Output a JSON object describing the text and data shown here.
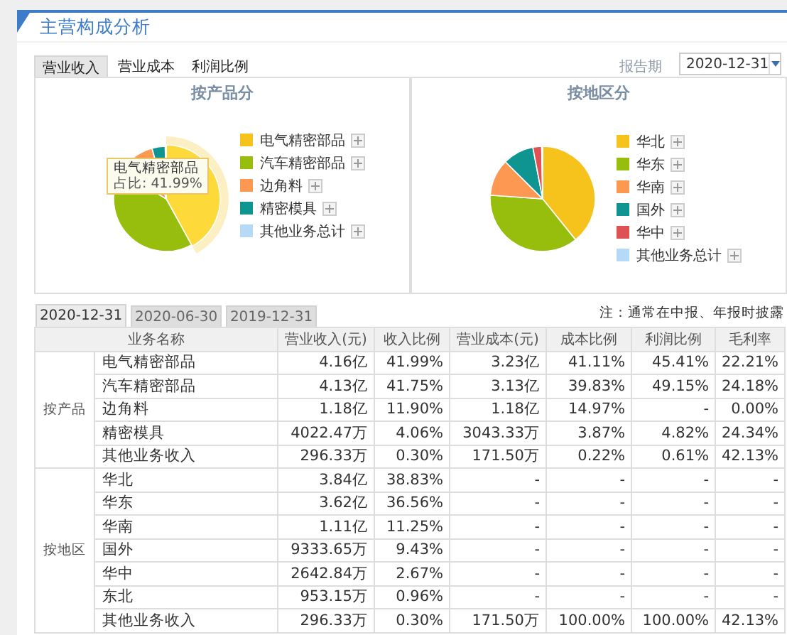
{
  "title": "主营构成分析",
  "tabs": [
    {
      "label": "营业收入",
      "selected": true
    },
    {
      "label": "营业成本",
      "selected": false
    },
    {
      "label": "利润比例",
      "selected": false
    }
  ],
  "report_period": {
    "label": "报告期",
    "value": "2020-12-31"
  },
  "charts": [
    {
      "title": "按产品分",
      "legend": [
        {
          "label": "电气精密部品",
          "color": "#f6c21c"
        },
        {
          "label": "汽车精密部品",
          "color": "#97be0d"
        },
        {
          "label": "边角料",
          "color": "#fd9853"
        },
        {
          "label": "精密模具",
          "color": "#0e9591"
        },
        {
          "label": "其他业务总计",
          "color": "#b5daf8"
        }
      ],
      "tooltip": {
        "title": "电气精密部品",
        "text": "占比: 41.99%"
      }
    },
    {
      "title": "按地区分",
      "legend": [
        {
          "label": "华北",
          "color": "#f6c21c"
        },
        {
          "label": "华东",
          "color": "#97be0d"
        },
        {
          "label": "华南",
          "color": "#fd9853"
        },
        {
          "label": "国外",
          "color": "#0e9591"
        },
        {
          "label": "华中",
          "color": "#de5253"
        },
        {
          "label": "其他业务总计",
          "color": "#b5daf8"
        }
      ]
    }
  ],
  "period_tabs": [
    {
      "label": "2020-12-31",
      "selected": true
    },
    {
      "label": "2020-06-30",
      "selected": false
    },
    {
      "label": "2019-12-31",
      "selected": false
    }
  ],
  "note": "注：通常在中报、年报时披露",
  "table": {
    "columns": [
      "业务名称",
      "营业收入(元)",
      "收入比例",
      "营业成本(元)",
      "成本比例",
      "利润比例",
      "毛利率"
    ],
    "groups": [
      {
        "label": "按产品",
        "rows": [
          [
            "电气精密部品",
            "4.16亿",
            "41.99%",
            "3.23亿",
            "41.11%",
            "45.41%",
            "22.21%"
          ],
          [
            "汽车精密部品",
            "4.13亿",
            "41.75%",
            "3.13亿",
            "39.83%",
            "49.15%",
            "24.18%"
          ],
          [
            "边角料",
            "1.18亿",
            "11.90%",
            "1.18亿",
            "14.97%",
            "-",
            "0.00%"
          ],
          [
            "精密模具",
            "4022.47万",
            "4.06%",
            "3043.33万",
            "3.87%",
            "4.82%",
            "24.34%"
          ],
          [
            "其他业务收入",
            "296.33万",
            "0.30%",
            "171.50万",
            "0.22%",
            "0.61%",
            "42.13%"
          ]
        ]
      },
      {
        "label": "按地区",
        "rows": [
          [
            "华北",
            "3.84亿",
            "38.83%",
            "-",
            "-",
            "-",
            "-"
          ],
          [
            "华东",
            "3.62亿",
            "36.56%",
            "-",
            "-",
            "-",
            "-"
          ],
          [
            "华南",
            "1.11亿",
            "11.25%",
            "-",
            "-",
            "-",
            "-"
          ],
          [
            "国外",
            "9333.65万",
            "9.43%",
            "-",
            "-",
            "-",
            "-"
          ],
          [
            "华中",
            "2642.84万",
            "2.67%",
            "-",
            "-",
            "-",
            "-"
          ],
          [
            "东北",
            "953.15万",
            "0.96%",
            "-",
            "-",
            "-",
            "-"
          ],
          [
            "其他业务收入",
            "296.33万",
            "0.30%",
            "171.50万",
            "100.00%",
            "100.00%",
            "42.13%"
          ]
        ]
      }
    ]
  }
}
